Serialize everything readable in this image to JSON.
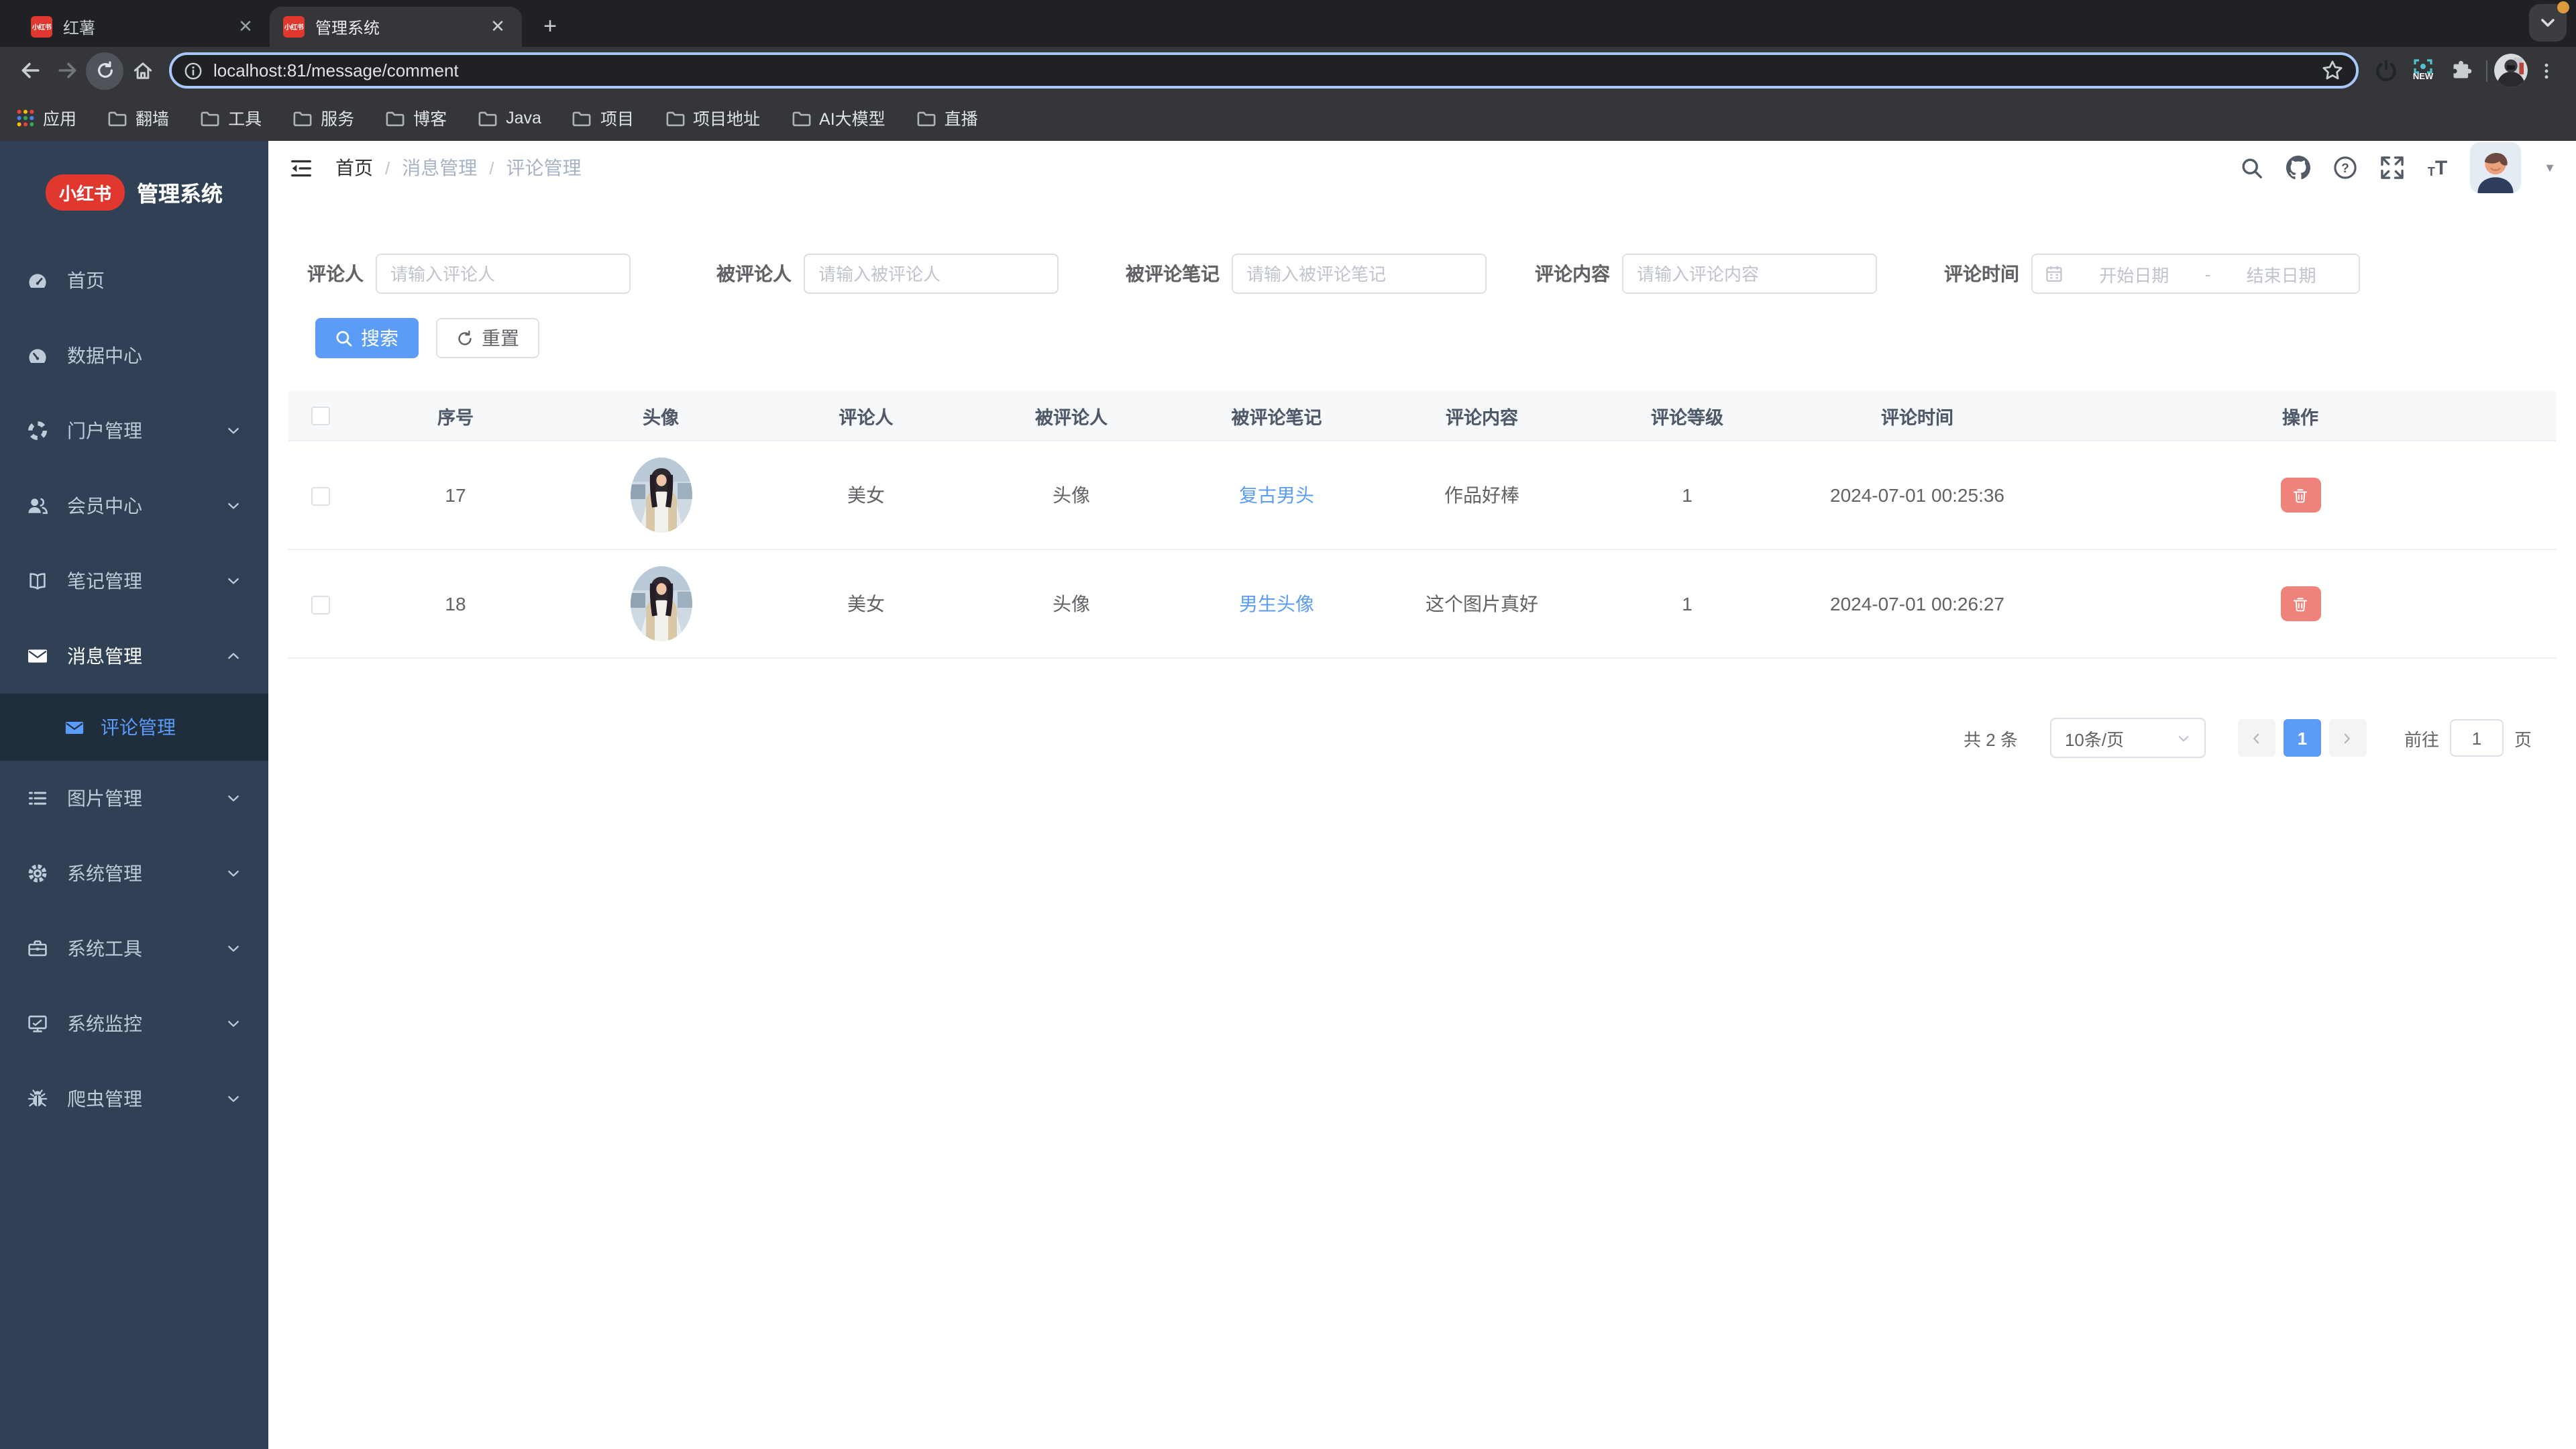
{
  "browser": {
    "tab1": {
      "title": "红薯",
      "favicon_text": "小红书"
    },
    "tab2": {
      "title": "管理系统",
      "favicon_text": "小红书"
    },
    "url": "localhost:81/message/comment",
    "extension_badge": "NEW",
    "bookmarks": [
      "应用",
      "翻墙",
      "工具",
      "服务",
      "博客",
      "Java",
      "项目",
      "项目地址",
      "AI大模型",
      "直播"
    ]
  },
  "sidebar": {
    "logo_badge": "小红书",
    "logo_title": "管理系统",
    "items": [
      {
        "label": "首页"
      },
      {
        "label": "数据中心"
      },
      {
        "label": "门户管理"
      },
      {
        "label": "会员中心"
      },
      {
        "label": "笔记管理"
      },
      {
        "label": "消息管理"
      },
      {
        "label": "图片管理"
      },
      {
        "label": "系统管理"
      },
      {
        "label": "系统工具"
      },
      {
        "label": "系统监控"
      },
      {
        "label": "爬虫管理"
      }
    ],
    "submenu_active": "评论管理"
  },
  "breadcrumb": [
    "首页",
    "消息管理",
    "评论管理"
  ],
  "filters": {
    "commenter": {
      "label": "评论人",
      "placeholder": "请输入评论人"
    },
    "commented": {
      "label": "被评论人",
      "placeholder": "请输入被评论人"
    },
    "note": {
      "label": "被评论笔记",
      "placeholder": "请输入被评论笔记"
    },
    "content": {
      "label": "评论内容",
      "placeholder": "请输入评论内容"
    },
    "time": {
      "label": "评论时间",
      "start_placeholder": "开始日期",
      "separator": "-",
      "end_placeholder": "结束日期"
    }
  },
  "buttons": {
    "search": "搜索",
    "reset": "重置"
  },
  "table": {
    "columns": [
      "序号",
      "头像",
      "评论人",
      "被评论人",
      "被评论笔记",
      "评论内容",
      "评论等级",
      "评论时间",
      "操作"
    ],
    "rows": [
      {
        "seq": "17",
        "commenter": "美女",
        "commented": "头像",
        "note": "复古男头",
        "content": "作品好棒",
        "level": "1",
        "time": "2024-07-01 00:25:36"
      },
      {
        "seq": "18",
        "commenter": "美女",
        "commented": "头像",
        "note": "男生头像",
        "content": "这个图片真好",
        "level": "1",
        "time": "2024-07-01 00:26:27"
      }
    ]
  },
  "pagination": {
    "total": "共 2 条",
    "page_size": "10条/页",
    "current_page": "1",
    "goto_label": "前往",
    "goto_value": "1",
    "page_unit": "页"
  },
  "colors": {
    "accent": "#5a9cf8",
    "sidebar_bg": "#304156",
    "sidebar_active_bg": "#1f2d3d",
    "danger": "#ef827a",
    "brand_red": "#e0382e"
  }
}
